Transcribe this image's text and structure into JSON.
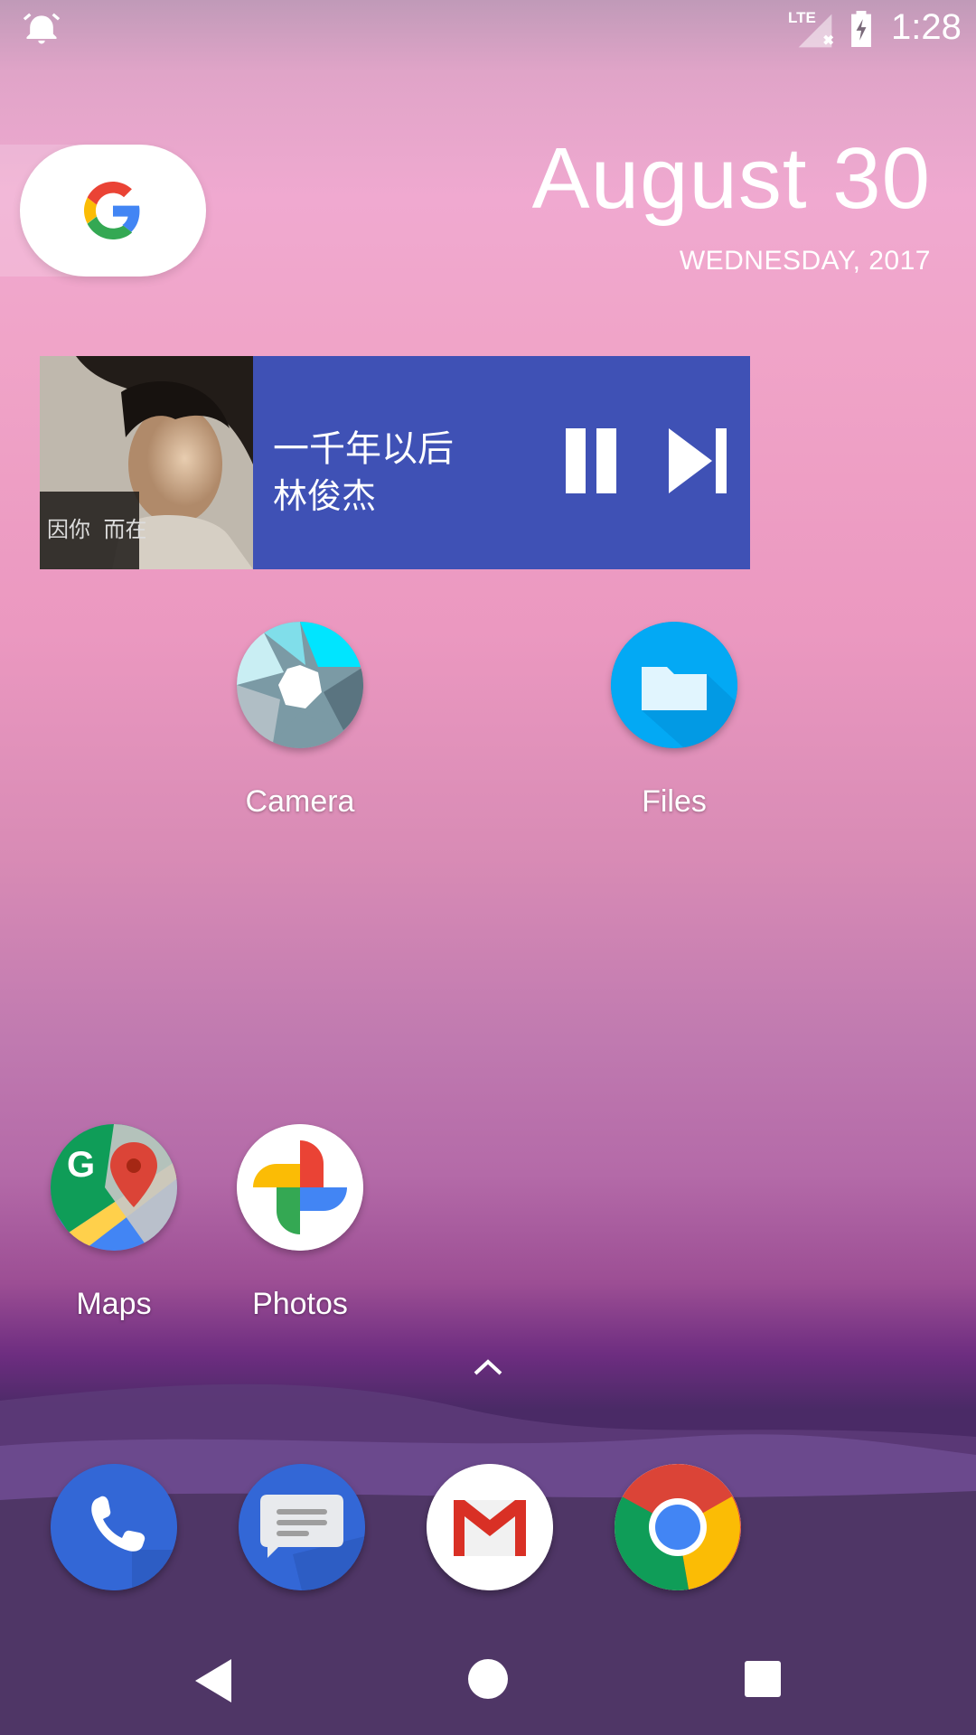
{
  "status_bar": {
    "time": "1:28",
    "network_label": "LTE",
    "icons": [
      "alarm-icon",
      "signal-no-service-icon",
      "battery-charging-icon"
    ]
  },
  "search_widget": {
    "icon": "google-g-icon"
  },
  "clock_widget": {
    "date": "August 30",
    "day": "WEDNESDAY, 2017"
  },
  "music_widget": {
    "title": "一千年以后",
    "artist": "林俊杰",
    "album_art_text": "因你 而在",
    "accent": "#3f51b5",
    "controls": [
      "pause-icon",
      "skip-next-icon"
    ]
  },
  "apps": [
    {
      "label": "Camera",
      "icon": "camera-icon"
    },
    {
      "label": "Files",
      "icon": "files-icon"
    },
    {
      "label": "Maps",
      "icon": "maps-icon"
    },
    {
      "label": "Photos",
      "icon": "photos-icon"
    }
  ],
  "dock": [
    {
      "icon": "phone-icon"
    },
    {
      "icon": "messages-icon"
    },
    {
      "icon": "gmail-icon"
    },
    {
      "icon": "chrome-icon"
    }
  ],
  "nav_bar": {
    "icons": [
      "back-icon",
      "home-icon",
      "recents-icon"
    ]
  }
}
